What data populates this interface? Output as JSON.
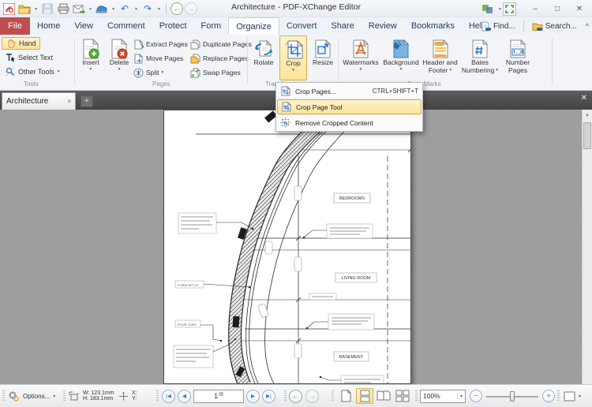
{
  "glyphs": {
    "dropdown": "▾",
    "close": "✕",
    "minimize": "–",
    "maximize": "□",
    "plus": "+",
    "collapse": "^",
    "tab_close": "×",
    "nav_first": "|◀",
    "nav_prev": "◀",
    "nav_next": "▶",
    "nav_last": "▶|",
    "back": "←",
    "forward": "→",
    "minus": "−",
    "undo": "↶",
    "redo": "↷",
    "scroll_up": "▲"
  },
  "titlebar": {
    "title": "Architecture - PDF-XChange Editor"
  },
  "menubar": {
    "file": "File",
    "tabs": [
      "Home",
      "View",
      "Comment",
      "Protect",
      "Form",
      "Organize",
      "Convert",
      "Share",
      "Review",
      "Bookmarks",
      "Help"
    ],
    "find": "Find...",
    "search": "Search..."
  },
  "ribbon": {
    "tools": {
      "group": "Tools",
      "hand": "Hand",
      "select_text": "Select Text",
      "other_tools": "Other Tools"
    },
    "pages": {
      "group": "Pages",
      "insert": "Insert",
      "delete": "Delete",
      "col1": [
        "Extract Pages",
        "Move Pages",
        "Split"
      ],
      "col2": [
        "Duplicate Pages",
        "Replace Pages",
        "Swap Pages"
      ]
    },
    "transform": {
      "group": "Transform",
      "rotate": "Rotate",
      "crop": "Crop",
      "resize": "Resize"
    },
    "marks": {
      "group": "Page Marks",
      "watermarks": "Watermarks",
      "background": "Background",
      "header1": "Header and",
      "header2": "Footer",
      "bates1": "Bates",
      "bates2": "Numbering",
      "number1": "Number",
      "number2": "Pages"
    }
  },
  "crop_menu": {
    "items": [
      {
        "label": "Crop Pages...",
        "shortcut": "CTRL+SHIFT+T"
      },
      {
        "label": "Crop Page Tool",
        "shortcut": ""
      },
      {
        "label": "Remove Cropped Content",
        "shortcut": ""
      }
    ]
  },
  "tabbar": {
    "title": "Architecture"
  },
  "document": {
    "rooms": [
      "BEDROOMS",
      "LIVING ROOM",
      "BASEMENT"
    ],
    "notes": {
      "form_set": "FORM SET AT",
      "pour_joint": "POUR JOINT"
    }
  },
  "statusbar": {
    "options": "Options...",
    "width": "W: 123.1mm",
    "height": "H: 183.1mm",
    "x": "X:",
    "y": "Y:",
    "page_current": "1",
    "page_total": "/8",
    "zoom": "100%"
  },
  "colors": {
    "highlight": "#fbe49a",
    "highlight_border": "#d8ae52",
    "accent_blue": "#2e77c9",
    "accent_green": "#58a33a",
    "accent_red": "#d04437",
    "file_tab": "#bf4e4e"
  }
}
